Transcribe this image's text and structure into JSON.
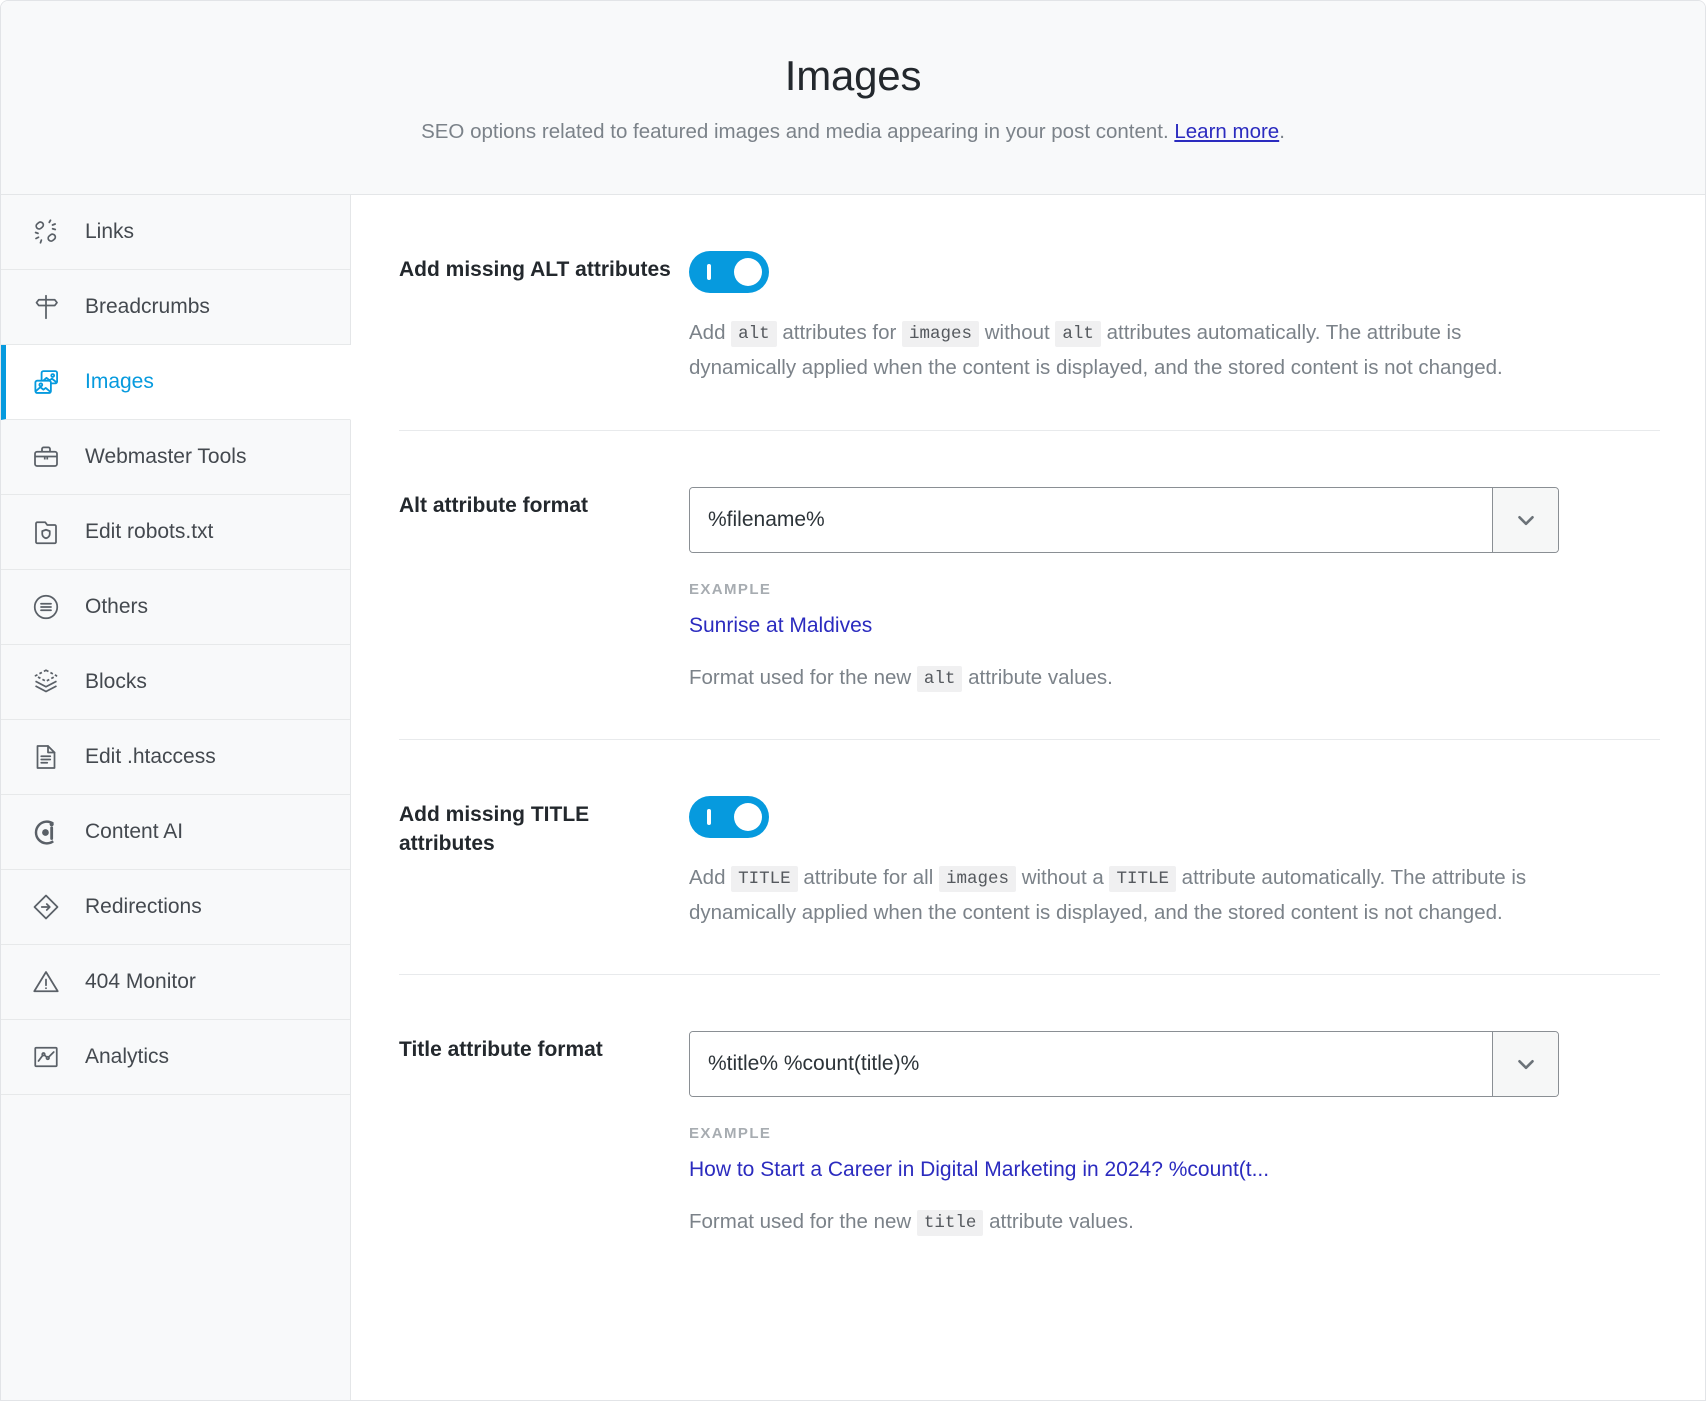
{
  "header": {
    "title": "Images",
    "subtitle_before": "SEO options related to featured images and media appearing in your post content. ",
    "learn_more": "Learn more",
    "subtitle_after": "."
  },
  "sidebar": {
    "items": [
      {
        "label": "Links",
        "icon": "links-icon",
        "active": false
      },
      {
        "label": "Breadcrumbs",
        "icon": "signpost-icon",
        "active": false
      },
      {
        "label": "Images",
        "icon": "images-icon",
        "active": true
      },
      {
        "label": "Webmaster Tools",
        "icon": "briefcase-icon",
        "active": false
      },
      {
        "label": "Edit robots.txt",
        "icon": "robot-folder-icon",
        "active": false
      },
      {
        "label": "Others",
        "icon": "list-circle-icon",
        "active": false
      },
      {
        "label": "Blocks",
        "icon": "layers-icon",
        "active": false
      },
      {
        "label": "Edit .htaccess",
        "icon": "document-lines-icon",
        "active": false
      },
      {
        "label": "Content AI",
        "icon": "content-ai-icon",
        "active": false
      },
      {
        "label": "Redirections",
        "icon": "redirect-diamond-icon",
        "active": false
      },
      {
        "label": "404 Monitor",
        "icon": "warning-triangle-icon",
        "active": false
      },
      {
        "label": "Analytics",
        "icon": "analytics-chart-icon",
        "active": false
      }
    ]
  },
  "main": {
    "rows": {
      "alt_toggle": {
        "label": "Add missing ALT attributes",
        "toggle_on": true,
        "help": {
          "p1": "Add ",
          "c1": "alt",
          "p2": " attributes for ",
          "c2": "images",
          "p3": " without ",
          "c3": "alt",
          "p4": " attributes automatically. The attribute is dynamically applied when the content is displayed, and the stored content is not changed."
        }
      },
      "alt_format": {
        "label": "Alt attribute format",
        "value": "%filename%",
        "placeholder": "%filename%",
        "example_label": "EXAMPLE",
        "example_value": "Sunrise at Maldives",
        "note": {
          "p1": "Format used for the new ",
          "c1": "alt",
          "p2": " attribute values."
        }
      },
      "title_toggle": {
        "label": "Add missing TITLE attributes",
        "toggle_on": true,
        "help": {
          "p1": "Add ",
          "c1": "TITLE",
          "p2": " attribute for all ",
          "c2": "images",
          "p3": " without a ",
          "c3": "TITLE",
          "p4": " attribute automatically. The attribute is dynamically applied when the content is displayed, and the stored content is not changed."
        }
      },
      "title_format": {
        "label": "Title attribute format",
        "value": "%title% %count(title)%",
        "placeholder": "%title% %count(title)%",
        "example_label": "EXAMPLE",
        "example_value": "How to Start a Career in Digital Marketing in 2024? %count(t...",
        "note": {
          "p1": "Format used for the new ",
          "c1": "title",
          "p2": " attribute values."
        }
      }
    }
  },
  "colors": {
    "accent": "#069ade",
    "link": "#2b2bbf",
    "muted": "#7b8289",
    "header_bg": "#f8f9fa"
  }
}
